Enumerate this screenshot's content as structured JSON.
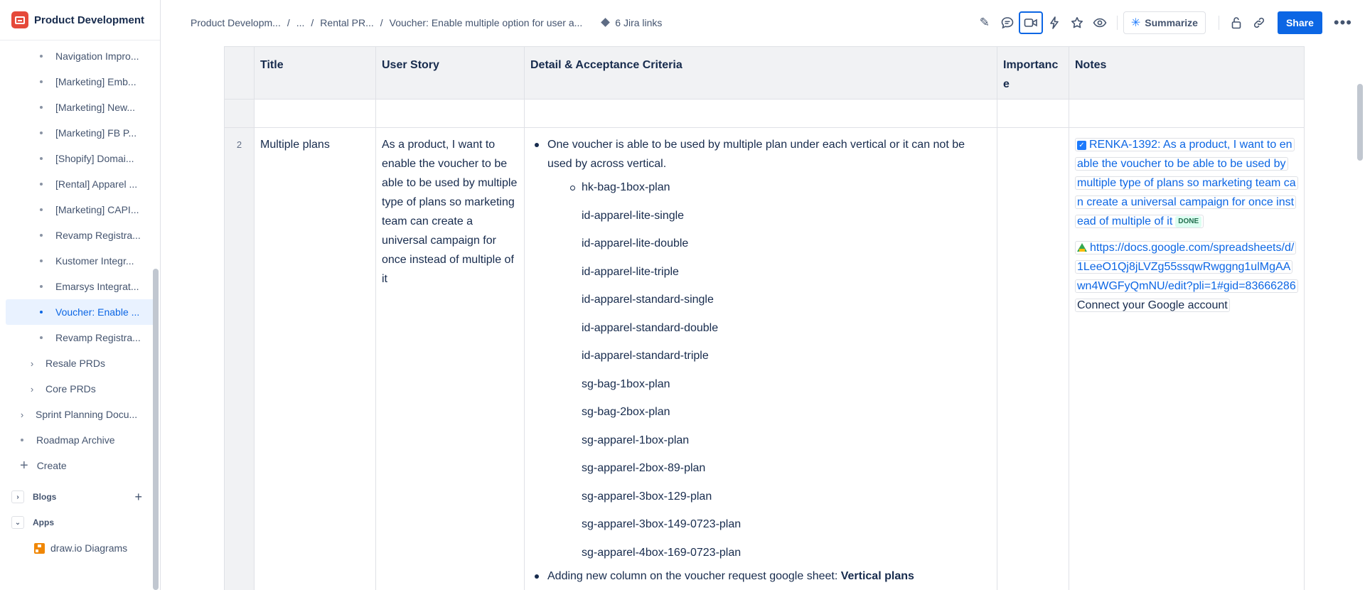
{
  "sidebar": {
    "space_title": "Product Development",
    "children": [
      "Navigation Impro...",
      "[Marketing] Emb...",
      "[Marketing] New...",
      "[Marketing] FB P...",
      "[Shopify] Domai...",
      "[Rental] Apparel ...",
      "[Marketing] CAPI...",
      "Revamp Registra...",
      "Kustomer Integr...",
      "Emarsys Integrat...",
      "Voucher: Enable ...",
      "Revamp Registra..."
    ],
    "resale": "Resale PRDs",
    "core": "Core PRDs",
    "sprint": "Sprint Planning Docu...",
    "roadmap": "Roadmap Archive",
    "create": "Create",
    "blogs": "Blogs",
    "apps": "Apps",
    "drawio": "draw.io Diagrams"
  },
  "header": {
    "crumb1": "Product Developm...",
    "crumb2": "...",
    "crumb3": "Rental PR...",
    "crumb4": "Voucher: Enable multiple option for user a...",
    "jira": "6 Jira links",
    "summarize": "Summarize",
    "share": "Share"
  },
  "table": {
    "headers": {
      "title": "Title",
      "story": "User Story",
      "criteria": "Detail & Acceptance Criteria",
      "importance_a": "Importanc",
      "importance_b": "e",
      "notes": "Notes"
    },
    "row": {
      "num": "2",
      "title": "Multiple plans",
      "story": "As a product, I want to enable the voucher to be able to be used by multiple type of plans so marketing team can create a universal campaign for once instead of multiple of it",
      "criteria_main": "One voucher is able to be used by multiple plan under each vertical or it can not be used by across vertical.",
      "plans": [
        "hk-bag-1box-plan",
        "id-apparel-lite-single",
        "id-apparel-lite-double",
        "id-apparel-lite-triple",
        "id-apparel-standard-single",
        "id-apparel-standard-double",
        "id-apparel-standard-triple",
        "sg-bag-1box-plan",
        "sg-bag-2box-plan",
        "sg-apparel-1box-plan",
        "sg-apparel-2box-89-plan",
        "sg-apparel-3box-129-plan",
        "sg-apparel-3box-149-0723-plan",
        "sg-apparel-4box-169-0723-plan"
      ],
      "criteria_second_prefix": "Adding new column on the voucher request google sheet: ",
      "criteria_second_bold": "Vertical plans",
      "jira_link": "RENKA-1392: As a product, I want to enable the voucher to be able to be used by multiple type of plans so marketing team can create a universal campaign for once instead of multiple of it",
      "status": "DONE",
      "sheet_link": "https://docs.google.com/spreadsheets/d/1LeeO1Qj8jLVZg55ssqwRwggng1ulMgAAwn4WGFyQmNU/edit?pli=1#gid=83666286",
      "connect": "Connect your Google account"
    }
  }
}
